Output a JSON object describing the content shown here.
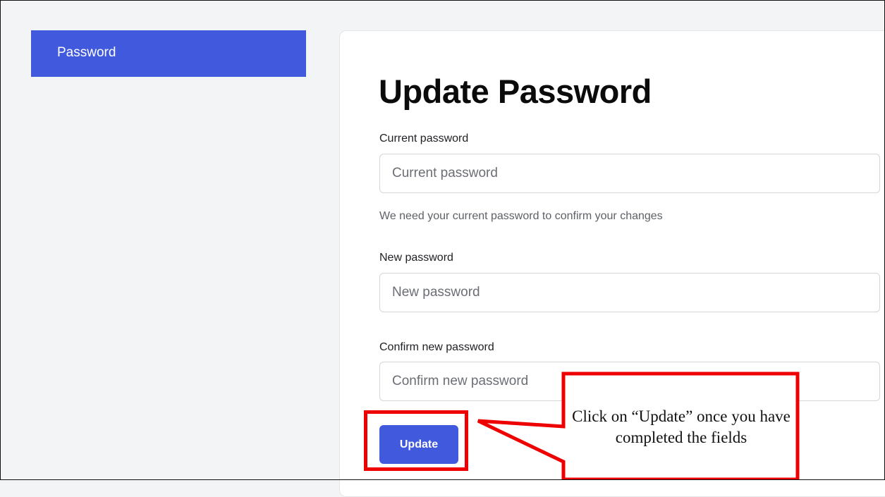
{
  "sidebar": {
    "items": [
      {
        "label": "Password",
        "active": true
      }
    ]
  },
  "main": {
    "title": "Update Password",
    "fields": [
      {
        "label": "Current password",
        "placeholder": "Current password",
        "value": ""
      },
      {
        "label": "New password",
        "placeholder": "New password",
        "value": ""
      },
      {
        "label": "Confirm new password",
        "placeholder": "Confirm new password",
        "value": ""
      }
    ],
    "current_password_hint": "We need your current password to confirm your changes",
    "update_label": "Update"
  },
  "annotation": {
    "callout_text": "Click on “Update” once you have completed the fields",
    "color": "#ef0000"
  },
  "colors": {
    "accent": "#4159dd",
    "page_background": "#f3f4f6"
  }
}
